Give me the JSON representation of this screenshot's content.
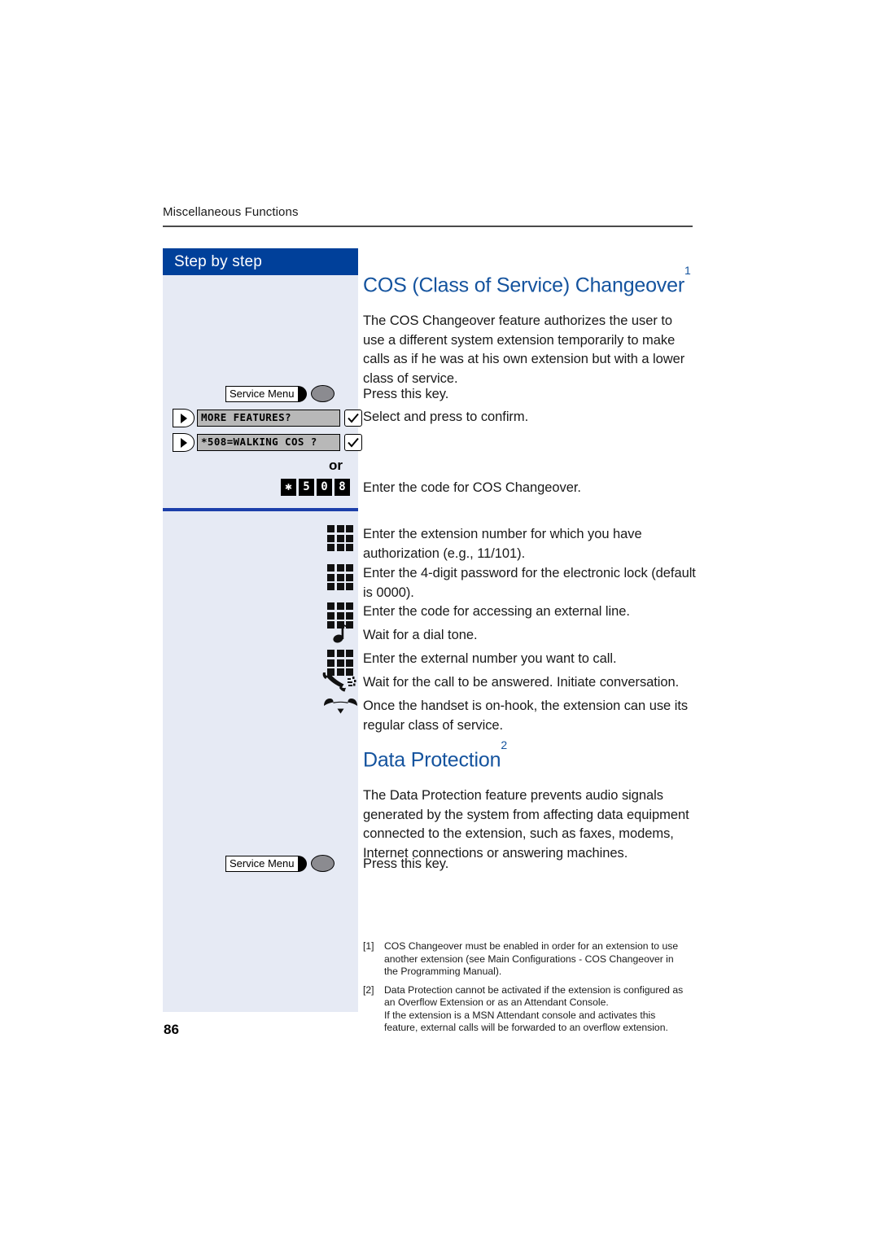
{
  "page": {
    "running_header": "Miscellaneous Functions",
    "folio": "86",
    "colors": {
      "heading_blue": "#14539e",
      "step_header_blue": "#00409a",
      "column_background": "#e6eaf4",
      "divider_blue": "#1c3faa"
    }
  },
  "sidebar": {
    "header_label": "Step by step",
    "keys": {
      "service_menu_1": {
        "label": "Service Menu",
        "icon": "service-menu-key-icon"
      },
      "menu_row_1": {
        "lcd_text": "MORE FEATURES?",
        "nav_icon": "nav-arrow-key-icon",
        "confirm_icon": "checkmark-key-icon"
      },
      "menu_row_2": {
        "lcd_text": "*508=WALKING COS ?",
        "nav_icon": "nav-arrow-key-icon",
        "confirm_icon": "checkmark-key-icon"
      },
      "or_label": "or",
      "code_digits": [
        "✱",
        "5",
        "0",
        "8"
      ],
      "service_menu_2": {
        "label": "Service Menu",
        "icon": "service-menu-key-icon"
      }
    }
  },
  "sections": [
    {
      "title": "COS (Class of Service) Changeover",
      "footnote_marker": "1",
      "intro": "The COS Changeover feature authorizes the user to use a different system extension temporarily to make calls as if he was at his own extension but with a lower class of service."
    },
    {
      "title": "Data Protection",
      "footnote_marker": "2",
      "intro": "The Data Protection feature prevents audio signals generated by the system from affecting data equipment connected to the extension, such as faxes, modems, Internet connections or answering machines."
    }
  ],
  "steps": [
    {
      "icon": "service-menu-key-icon",
      "text": "Press this key."
    },
    {
      "icon": "nav-arrow-key-icon",
      "text": "Select and press to confirm."
    },
    {
      "icon": "digit-keys-icon",
      "text": "Enter the code for COS Changeover."
    },
    {
      "icon": "keypad-icon",
      "text": "Enter the extension number for which you have authorization (e.g., 11/101)."
    },
    {
      "icon": "keypad-icon",
      "text": "Enter the 4-digit password for the electronic lock (default is 0000)."
    },
    {
      "icon": "keypad-icon",
      "text": "Enter the code for accessing an external line."
    },
    {
      "icon": "dial-tone-icon",
      "text": "Wait for a dial tone."
    },
    {
      "icon": "keypad-icon",
      "text": "Enter the external number you want to call."
    },
    {
      "icon": "handset-ringing-icon",
      "text": "Wait for the call to be answered. Initiate conversation."
    },
    {
      "icon": "handset-onhook-icon",
      "text": "Once the handset is on-hook, the extension can use its regular class of service."
    },
    {
      "icon": "service-menu-key-icon",
      "text": "Press this key."
    }
  ],
  "footnotes": [
    {
      "marker": "[1]",
      "text": "COS Changeover must be enabled in order for an extension to use another extension (see Main Configurations - COS Changeover in the Programming Manual)."
    },
    {
      "marker": "[2]",
      "text": "Data Protection cannot be activated if the extension is configured as an Overflow Extension or as an Attendant Console.",
      "text2": "If the extension is a MSN Attendant console and activates this feature, external calls will be forwarded to an overflow extension."
    }
  ]
}
